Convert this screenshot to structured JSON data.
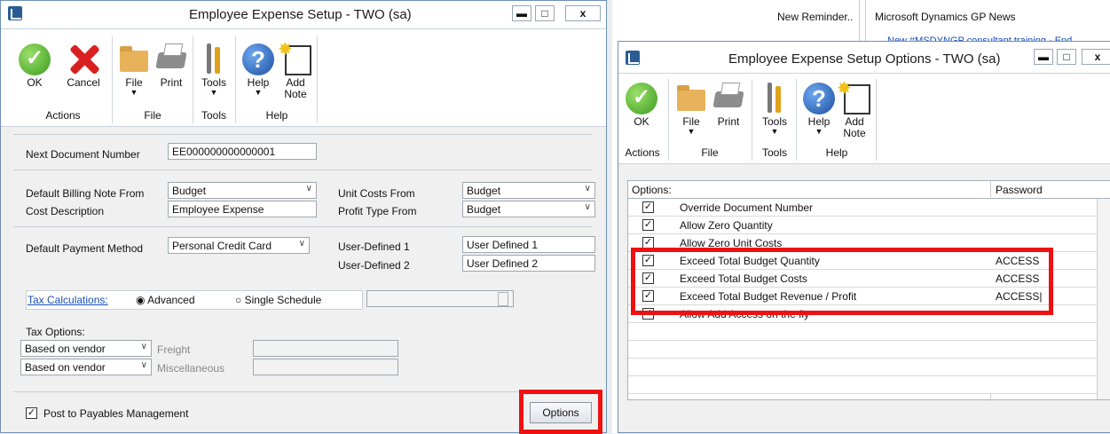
{
  "left_window": {
    "title": "Employee Expense Setup  -  TWO (sa)",
    "win_buttons": {
      "minimize": "▬",
      "maximize": "□",
      "close": "x"
    },
    "ribbon": {
      "ok": "OK",
      "cancel": "Cancel",
      "file": "File",
      "print": "Print",
      "tools": "Tools",
      "help": "Help",
      "add": "Add",
      "note": "Note",
      "groups": {
        "actions": "Actions",
        "file": "File",
        "tools": "Tools",
        "help": "Help"
      }
    },
    "form": {
      "next_doc_label": "Next Document Number",
      "next_doc_value": "EE000000000000001",
      "billing_label": "Default Billing Note From",
      "billing_value": "Budget",
      "cost_desc_label": "Cost Description",
      "cost_desc_value": "Employee Expense",
      "unit_costs_label": "Unit Costs From",
      "unit_costs_value": "Budget",
      "profit_type_label": "Profit Type From",
      "profit_type_value": "Budget",
      "payment_label": "Default Payment Method",
      "payment_value": "Personal Credit Card",
      "ud1_label": "User-Defined 1",
      "ud1_value": "User Defined 1",
      "ud2_label": "User-Defined 2",
      "ud2_value": "User Defined 2",
      "tax_calc_link": "Tax Calculations:",
      "tax_advanced": "Advanced",
      "tax_single": "Single Schedule",
      "tax_options_label": "Tax Options:",
      "tax_opt1_value": "Based on vendor",
      "tax_opt1_label": "Freight",
      "tax_opt2_value": "Based on vendor",
      "tax_opt2_label": "Miscellaneous",
      "post_payables": "Post to Payables Management",
      "options_button": "Options"
    }
  },
  "background": {
    "new_reminder": "New Reminder..",
    "gp_news": "Microsoft Dynamics GP News",
    "news_snippet": "New #MSDYNGP consultant training - End"
  },
  "right_window": {
    "title": "Employee Expense Setup Options  -  TWO (sa)",
    "win_buttons": {
      "minimize": "▬",
      "maximize": "□",
      "close": "x"
    },
    "ribbon": {
      "ok": "OK",
      "file": "File",
      "print": "Print",
      "tools": "Tools",
      "help": "Help",
      "add": "Add",
      "note": "Note",
      "groups": {
        "actions": "Actions",
        "file": "File",
        "tools": "Tools",
        "help": "Help"
      }
    },
    "grid": {
      "col_options": "Options:",
      "col_password": "Password",
      "rows": [
        {
          "checked": true,
          "option": "Override Document Number",
          "password": ""
        },
        {
          "checked": true,
          "option": "Allow Zero Quantity",
          "password": ""
        },
        {
          "checked": true,
          "option": "Allow Zero Unit Costs",
          "password": ""
        },
        {
          "checked": true,
          "option": "Exceed Total Budget Quantity",
          "password": "ACCESS"
        },
        {
          "checked": true,
          "option": "Exceed Total Budget Costs",
          "password": "ACCESS"
        },
        {
          "checked": true,
          "option": "Exceed Total Budget Revenue / Profit",
          "password": "ACCESS|"
        },
        {
          "checked": true,
          "option": "Allow Add Access on the fly",
          "password": ""
        }
      ]
    }
  },
  "colors": {
    "highlight": "#ee1111",
    "link": "#1a4fb5",
    "accent": "#2a5c93"
  }
}
